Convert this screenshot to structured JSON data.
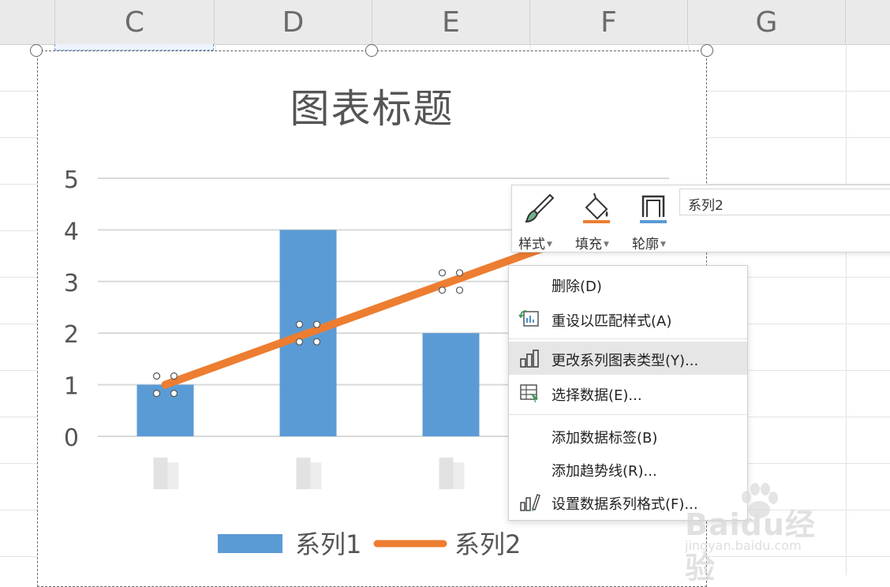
{
  "columns": [
    "C",
    "D",
    "E",
    "F",
    "G"
  ],
  "chart": {
    "title": "图表标题",
    "chart_data": {
      "type": "bar",
      "categories": [
        "",
        "",
        "",
        ""
      ],
      "series": [
        {
          "name": "系列1",
          "type": "bar",
          "values": [
            1,
            4,
            2,
            null
          ]
        },
        {
          "name": "系列2",
          "type": "line",
          "values": [
            1,
            2,
            3,
            4
          ]
        }
      ],
      "ylim": [
        0,
        5
      ],
      "yticks": [
        "0",
        "1",
        "2",
        "3",
        "4",
        "5"
      ],
      "grid": true,
      "legend": "bottom",
      "colors": {
        "系列1": "#5b9bd5",
        "系列2": "#ed7d31"
      }
    }
  },
  "legend": {
    "series1": "系列1",
    "series2": "系列2"
  },
  "toolbar": {
    "style": "样式",
    "fill": "填充",
    "outline": "轮廓",
    "series_selected": "系列2",
    "icons": {
      "style": "brush-icon",
      "fill": "fill-bucket-icon",
      "outline": "outline-icon"
    }
  },
  "menu": {
    "items": [
      {
        "label": "删除(D)",
        "icon": ""
      },
      {
        "label": "重设以匹配样式(A)",
        "icon": "reset-style-icon"
      },
      {
        "label": "更改系列图表类型(Y)...",
        "icon": "bar-chart-icon"
      },
      {
        "label": "选择数据(E)...",
        "icon": "select-data-icon"
      },
      {
        "label": "添加数据标签(B)",
        "icon": ""
      },
      {
        "label": "添加趋势线(R)...",
        "icon": ""
      },
      {
        "label": "设置数据系列格式(F)...",
        "icon": "format-series-icon"
      }
    ],
    "highlighted": 2
  },
  "watermark": {
    "text": "Baidu经验",
    "sub": "jingyan.baidu.com"
  }
}
